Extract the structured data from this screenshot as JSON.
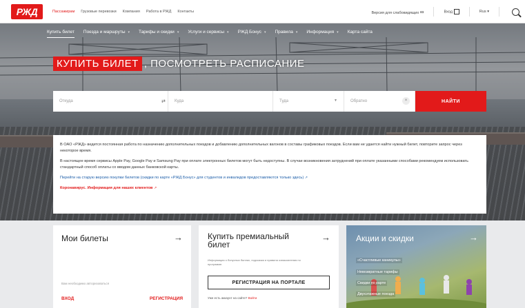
{
  "topbar": {
    "logo": "РЖД",
    "nav": [
      "Пассажирам",
      "Грузовые перевозки",
      "Компания",
      "Работа в РЖД",
      "Контакты"
    ],
    "accessible_version": "Версия для слабовидящих",
    "login": "Вход",
    "language": "Rus"
  },
  "hero": {
    "nav": [
      "Купить билет",
      "Поезда и маршруты",
      "Тарифы и скидки",
      "Услуги и сервисы",
      "РЖД Бонус",
      "Правила",
      "Информация",
      "Карта сайта"
    ],
    "headline_red": "КУПИТЬ БИЛЕТ",
    "headline_rest": ", ПОСМОТРЕТЬ РАСПИСАНИЕ"
  },
  "search": {
    "from_placeholder": "Откуда",
    "to_placeholder": "Куда",
    "there_placeholder": "Туда",
    "back_placeholder": "Обратно",
    "find_label": "НАЙТИ"
  },
  "notice": {
    "p1": "В ОАО «РЖД» ведется постоянная работа по назначению дополнительных поездов и добавлению дополнительных вагонов в составы графиковых поездов. Если вам не удается найти нужный билет, повторите запрос через некоторое время.",
    "p2": "В настоящее время сервисы Apple Pay, Google Pay и Samsung Pay при оплате электронных билетов могут быть недоступны. В случае возникновения затруднений при оплате указанными способами рекомендуем использовать стандартный способ оплаты со вводом данных банковской карты.",
    "old_version_link": "Перейти на старую версию покупки билетов (скидки по карте «РЖД Бонус» для студентов и инвалидов предоставляются только здесь)",
    "covid_link": "Коронавирус. Информация для наших клиентов"
  },
  "cards": {
    "my_tickets": {
      "title": "Мои билеты",
      "hint": "Вам необходимо авторизоваться",
      "login": "ВХОД",
      "register": "РЕГИСТРАЦИЯ"
    },
    "premium": {
      "title": "Купить премиальный билет",
      "desc": "Информация о бонусных баллах, подсказки и правила ознакомления по программе.",
      "button": "РЕГИСТРАЦИЯ НА ПОРТАЛЕ",
      "footer_text": "Уже есть аккаунт на сайте?",
      "footer_link": "Войти"
    },
    "promo": {
      "title": "Акции и скидки",
      "items": [
        "«Счастливые каникулы»",
        "Невозвратные тарифы",
        "Скидки по карте",
        "Двухэтажные поезда"
      ]
    }
  },
  "colors": {
    "brand_red": "#e21a1a",
    "link_blue": "#1a5ca8"
  }
}
